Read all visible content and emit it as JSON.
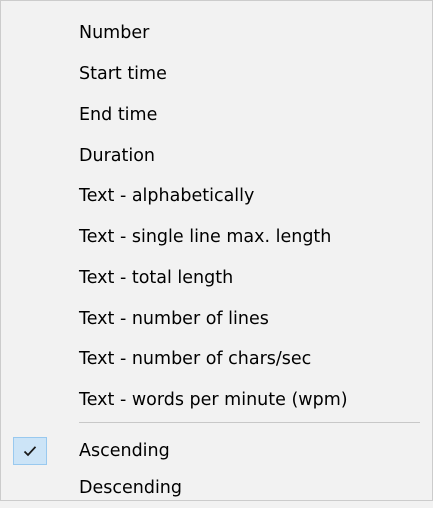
{
  "menu": {
    "sort_by": [
      {
        "label": "Number"
      },
      {
        "label": "Start time"
      },
      {
        "label": "End time"
      },
      {
        "label": "Duration"
      },
      {
        "label": "Text - alphabetically"
      },
      {
        "label": "Text - single line max. length"
      },
      {
        "label": "Text - total length"
      },
      {
        "label": "Text - number of lines"
      },
      {
        "label": "Text - number of chars/sec"
      },
      {
        "label": "Text - words per minute (wpm)"
      }
    ],
    "order": [
      {
        "label": "Ascending",
        "checked": true
      },
      {
        "label": "Descending",
        "checked": false
      }
    ]
  },
  "icons": {
    "check": "checkmark-icon"
  },
  "colors": {
    "menu_background": "#f2f2f2",
    "check_highlight": "#cce4f7",
    "check_border": "#99c9ef",
    "separator": "#c8c8c8"
  }
}
